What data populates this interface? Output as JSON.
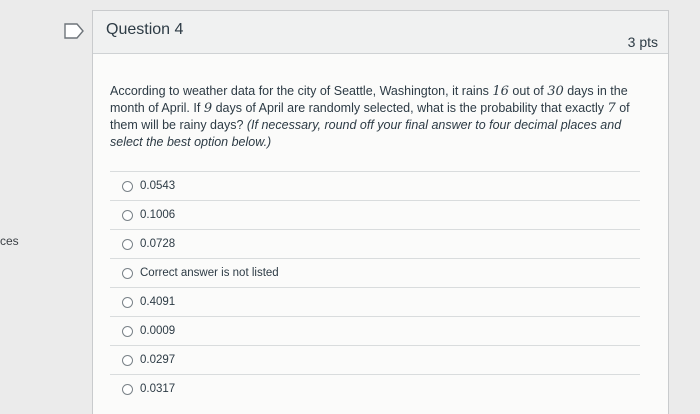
{
  "sidebar": {
    "fragment_text": "ces"
  },
  "question": {
    "title": "Question 4",
    "points": "3 pts",
    "text": {
      "part1": "According to weather data for the city of Seattle, Washington, it rains",
      "rain_days": "16",
      "part2": "out of",
      "total_days": "30",
      "part3": "days in the month of April. If",
      "selected_days": "9",
      "part4": "days of April are randomly selected, what is the probability that exactly",
      "exact_days": "7",
      "part5": "of them will be rainy days?",
      "instruction": "(If necessary, round off your final answer to four decimal places and select the best option below.)"
    },
    "answers": [
      "0.0543",
      "0.1006",
      "0.0728",
      "Correct answer is not listed",
      "0.4091",
      "0.0009",
      "0.0297",
      "0.0317"
    ]
  },
  "colors": {
    "card_bg": "#fbfbfa",
    "header_bg": "#f0f1f1",
    "text": "#2d3b45",
    "border": "#d9dcdd",
    "page_bg": "#ebebeb"
  },
  "icons": {
    "flag": "bookmark-flag-icon"
  }
}
